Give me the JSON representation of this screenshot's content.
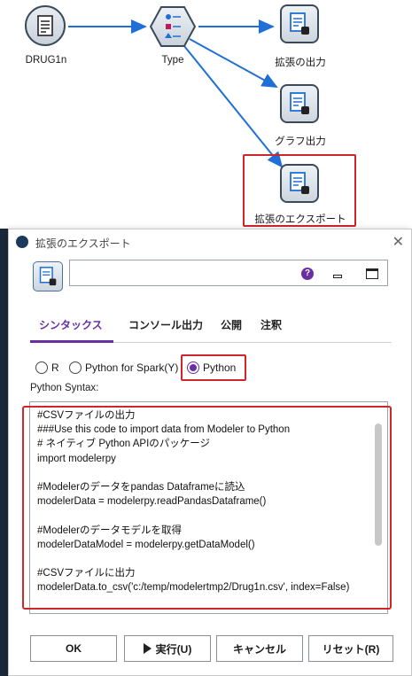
{
  "canvas": {
    "nodes": [
      {
        "id": "drug1n",
        "label": "DRUG1n",
        "icon": "source-file-icon"
      },
      {
        "id": "type",
        "label": "Type",
        "icon": "type-node-icon"
      },
      {
        "id": "ext_output",
        "label": "拡張の出力",
        "icon": "extension-output-icon"
      },
      {
        "id": "graph_output",
        "label": "グラフ出力",
        "icon": "graph-output-icon"
      },
      {
        "id": "ext_export",
        "label": "拡張のエクスポート",
        "icon": "extension-export-icon"
      }
    ],
    "highlight_color": "#d0252b",
    "link_color": "#1f6fd6"
  },
  "dialog": {
    "title": "拡張のエクスポート",
    "close_glyph": "✕",
    "name_value": "",
    "help_glyph": "?",
    "tabs": [
      {
        "label": "シンタックス",
        "active": true
      },
      {
        "label": "コンソール出力",
        "active": false
      },
      {
        "label": "公開",
        "active": false
      },
      {
        "label": "注釈",
        "active": false
      }
    ],
    "radios": [
      {
        "label": "R",
        "selected": false
      },
      {
        "label": "Python for Spark(Y)",
        "selected": false
      },
      {
        "label": "Python",
        "selected": true
      }
    ],
    "syntax_label": "Python Syntax:",
    "code_lines": [
      "#CSVファイルの出力",
      "###Use this code to import data from Modeler to Python",
      "# ネイティブ Python APIのパッケージ",
      "import modelerpy",
      "",
      "#Modelerのデータをpandas Dataframeに読込",
      "modelerData = modelerpy.readPandasDataframe()",
      "",
      "#Modelerのデータモデルを取得",
      "modelerDataModel = modelerpy.getDataModel()",
      "",
      "#CSVファイルに出力",
      "modelerData.to_csv('c:/temp/modelertmp2/Drug1n.csv', index=False)"
    ],
    "buttons": {
      "ok": "OK",
      "run": "実行(U)",
      "cancel": "キャンセル",
      "reset": "リセット(R)"
    },
    "accent_color": "#6a2fa0"
  }
}
